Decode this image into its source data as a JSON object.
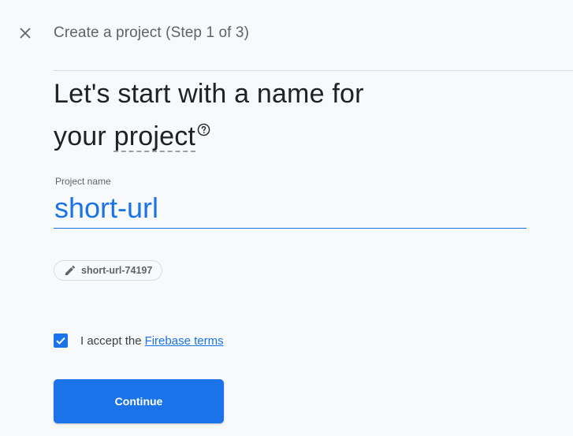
{
  "header": {
    "close_icon": "close-icon",
    "step_title": "Create a project (Step 1 of 3)"
  },
  "heading": {
    "line_start": "Let's start with a name for",
    "line2_prefix": "your ",
    "underlined_word": "project",
    "help_icon": "help-circle-icon"
  },
  "project_name": {
    "label": "Project name",
    "value": "short-url"
  },
  "project_id_chip": {
    "icon": "pencil-icon",
    "text": "short-url-74197"
  },
  "terms": {
    "checked": true,
    "text": "I accept the",
    "link_text": "Firebase terms"
  },
  "actions": {
    "continue_label": "Continue"
  },
  "colors": {
    "accent": "#1a73e8",
    "background": "#f8f9fa",
    "text_primary": "#202124",
    "text_secondary": "#5f6368"
  }
}
